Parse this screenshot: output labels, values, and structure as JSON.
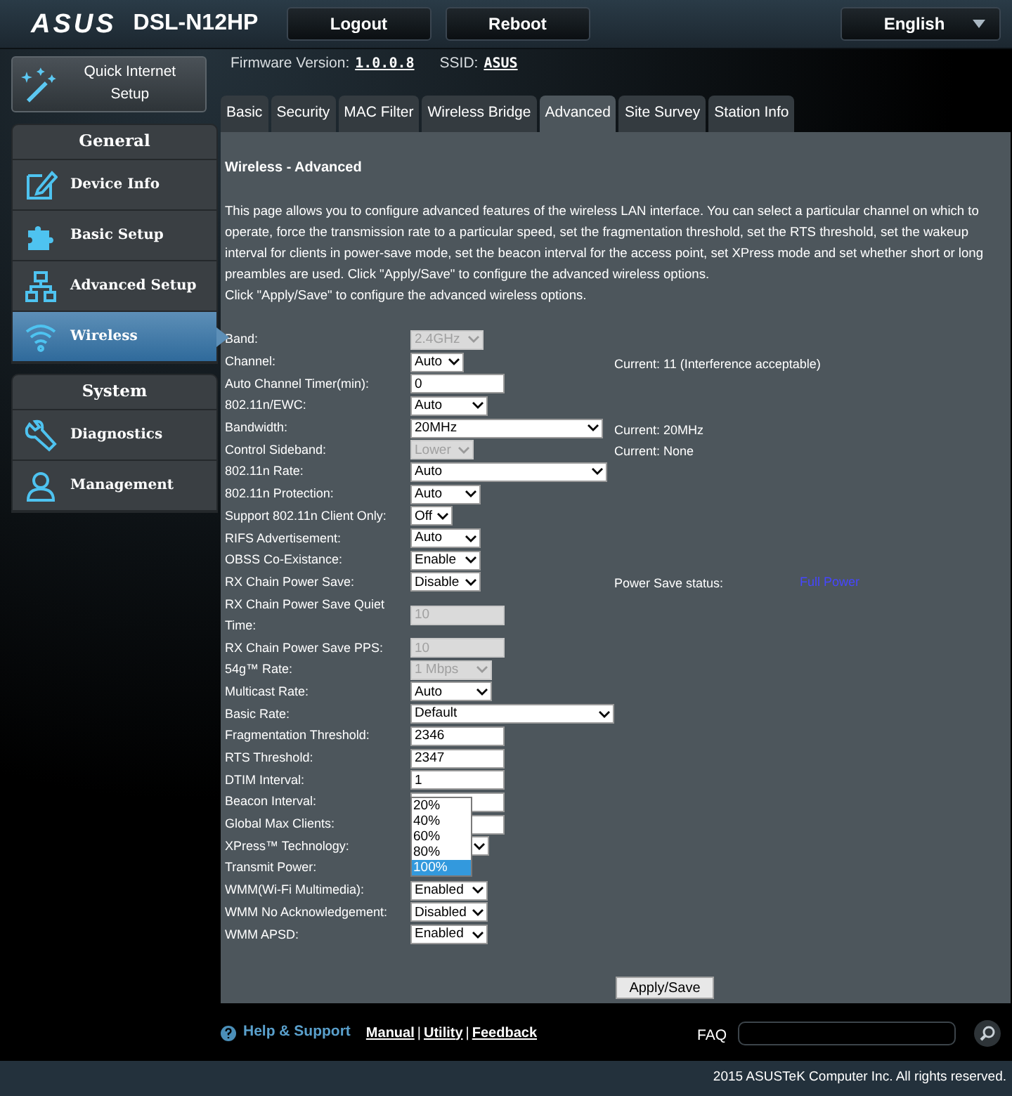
{
  "header": {
    "logo": "ASUS",
    "model": "DSL-N12HP",
    "buttons": [
      "Logout",
      "Reboot"
    ],
    "language": "English"
  },
  "info": {
    "firmware_label": "Firmware Version:",
    "firmware": "1.0.0.8",
    "ssid_label": "SSID:",
    "ssid": "ASUS"
  },
  "quick_setup": "Quick Internet Setup",
  "sidebar": [
    {
      "title": "General",
      "items": [
        {
          "label": "Device Info",
          "kind": "edit",
          "selected": false
        },
        {
          "label": "Basic Setup",
          "kind": "puzzle",
          "selected": false
        },
        {
          "label": "Advanced Setup",
          "kind": "network",
          "selected": false
        },
        {
          "label": "Wireless",
          "kind": "wifi",
          "selected": true
        }
      ]
    },
    {
      "title": "System",
      "items": [
        {
          "label": "Diagnostics",
          "kind": "wrench",
          "selected": false
        },
        {
          "label": "Management",
          "kind": "person",
          "selected": false
        }
      ]
    }
  ],
  "tabs": [
    {
      "label": "Basic",
      "selected": false
    },
    {
      "label": "Security",
      "selected": false
    },
    {
      "label": "MAC Filter",
      "selected": false
    },
    {
      "label": "Wireless Bridge",
      "selected": false
    },
    {
      "label": "Advanced",
      "selected": true
    },
    {
      "label": "Site Survey",
      "selected": false
    },
    {
      "label": "Station Info",
      "selected": false
    }
  ],
  "section_title": "Wireless - Advanced",
  "description": "This page allows you to configure advanced features of the wireless LAN interface. You can select a particular channel on which to operate, force the transmission rate to a particular speed, set the fragmentation threshold, set the RTS threshold, set the wakeup interval for clients in power-save mode, set the beacon interval for the access point, set XPress mode and set whether short or long preambles are used. Click \"Apply/Save\" to configure the advanced wireless options.",
  "description_2": "Click \"Apply/Save\" to configure the advanced wireless options.",
  "settings": [
    {
      "label": "Band:",
      "kind": "select",
      "value": "2.4GHz",
      "disabled": true
    },
    {
      "label": "Channel:",
      "kind": "select",
      "value": "Auto",
      "disabled": false,
      "note": "Current: 11 (Interference acceptable)"
    },
    {
      "label": "Auto Channel Timer(min):",
      "kind": "input",
      "value": "0",
      "disabled": false
    },
    {
      "label": "802.11n/EWC:",
      "kind": "select",
      "value": "Auto",
      "disabled": false
    },
    {
      "label": "Bandwidth:",
      "kind": "select",
      "value": "20MHz",
      "disabled": false,
      "note": "Current: 20MHz"
    },
    {
      "label": "Control Sideband:",
      "kind": "select",
      "value": "Lower",
      "disabled": true,
      "note": "Current: None"
    },
    {
      "label": "802.11n Rate:",
      "kind": "select",
      "value": "Auto",
      "disabled": false
    },
    {
      "label": "802.11n Protection:",
      "kind": "select",
      "value": "Auto",
      "disabled": false
    },
    {
      "label": "Support 802.11n Client Only:",
      "kind": "select",
      "value": "Off",
      "disabled": false
    },
    {
      "label": "RIFS Advertisement:",
      "kind": "select",
      "value": "Auto",
      "disabled": false
    },
    {
      "label": "OBSS Co-Existance:",
      "kind": "select",
      "value": "Enable",
      "disabled": false
    },
    {
      "label": "RX Chain Power Save:",
      "kind": "select",
      "value": "Disable",
      "disabled": false,
      "note": "Power Save status:",
      "status": "Full Power"
    },
    {
      "label": "RX Chain Power Save Quiet Time:",
      "kind": "input",
      "value": "10",
      "disabled": true
    },
    {
      "label": "RX Chain Power Save PPS:",
      "kind": "input",
      "value": "10",
      "disabled": true
    },
    {
      "label": "54g™ Rate:",
      "kind": "select",
      "value": "1 Mbps",
      "disabled": true
    },
    {
      "label": "Multicast Rate:",
      "kind": "select",
      "value": "Auto",
      "disabled": false
    },
    {
      "label": "Basic Rate:",
      "kind": "select",
      "value": "Default",
      "disabled": false
    },
    {
      "label": "Fragmentation Threshold:",
      "kind": "input",
      "value": "2346",
      "disabled": false
    },
    {
      "label": "RTS Threshold:",
      "kind": "input",
      "value": "2347",
      "disabled": false
    },
    {
      "label": "DTIM Interval:",
      "kind": "input",
      "value": "1",
      "disabled": false
    },
    {
      "label": "Beacon Interval:",
      "kind": "input",
      "disabled": false
    },
    {
      "label": "Global Max Clients:",
      "kind": "input",
      "disabled": false
    },
    {
      "label": "XPress™ Technology:",
      "kind": "select",
      "disabled": false
    },
    {
      "label": "Transmit Power:",
      "kind": "open_list",
      "options": [
        {
          "label": "20%",
          "selected": false
        },
        {
          "label": "40%",
          "selected": false
        },
        {
          "label": "60%",
          "selected": false
        },
        {
          "label": "80%",
          "selected": false
        },
        {
          "label": "100%",
          "selected": true
        }
      ]
    },
    {
      "label": "WMM(Wi-Fi Multimedia):",
      "kind": "select",
      "value": "Enabled",
      "disabled": false
    },
    {
      "label": "WMM No Acknowledgement:",
      "kind": "select",
      "value": "Disabled",
      "disabled": false
    },
    {
      "label": "WMM APSD:",
      "kind": "select",
      "value": "Enabled",
      "disabled": false
    }
  ],
  "apply_button": "Apply/Save",
  "footer": {
    "help": "Help & Support",
    "links": [
      "Manual",
      "|",
      "Utility",
      "|",
      "Feedback"
    ],
    "faq_label": "FAQ"
  },
  "copyright": "2015 ASUSTeK Computer Inc. All rights reserved."
}
